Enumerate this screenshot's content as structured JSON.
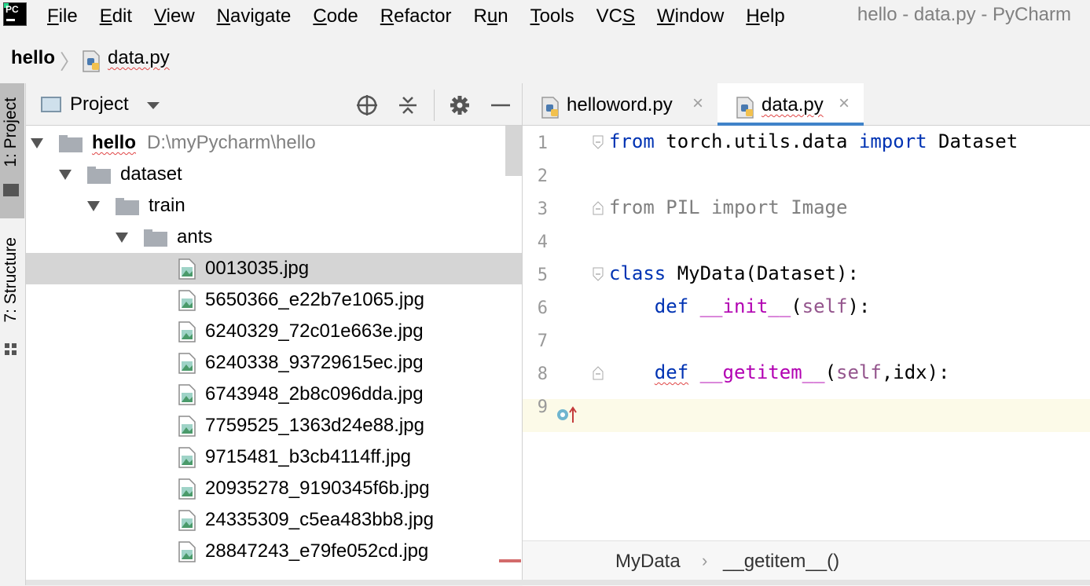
{
  "menubar": {
    "items": [
      {
        "pre": "",
        "mn": "F",
        "post": "ile"
      },
      {
        "pre": "",
        "mn": "E",
        "post": "dit"
      },
      {
        "pre": "",
        "mn": "V",
        "post": "iew"
      },
      {
        "pre": "",
        "mn": "N",
        "post": "avigate"
      },
      {
        "pre": "",
        "mn": "C",
        "post": "ode"
      },
      {
        "pre": "",
        "mn": "R",
        "post": "efactor"
      },
      {
        "pre": "R",
        "mn": "u",
        "post": "n"
      },
      {
        "pre": "",
        "mn": "T",
        "post": "ools"
      },
      {
        "pre": "VC",
        "mn": "S",
        "post": ""
      },
      {
        "pre": "",
        "mn": "W",
        "post": "indow"
      },
      {
        "pre": "",
        "mn": "H",
        "post": "elp"
      }
    ],
    "window_title": "hello - data.py - PyCharm",
    "logo_text": "PC"
  },
  "navbar": {
    "root": "hello",
    "file": "data.py"
  },
  "left_strip": {
    "project_label": "1: Project",
    "structure_label": "7: Structure"
  },
  "project_panel": {
    "title": "Project",
    "tree": [
      {
        "label": "hello",
        "path": "D:\\myPycharm\\hello",
        "type": "root"
      },
      {
        "label": "dataset",
        "type": "folder"
      },
      {
        "label": "train",
        "type": "folder"
      },
      {
        "label": "ants",
        "type": "folder"
      },
      {
        "label": "0013035.jpg",
        "type": "file",
        "selected": true
      },
      {
        "label": "5650366_e22b7e1065.jpg",
        "type": "file"
      },
      {
        "label": "6240329_72c01e663e.jpg",
        "type": "file"
      },
      {
        "label": "6240338_93729615ec.jpg",
        "type": "file"
      },
      {
        "label": "6743948_2b8c096dda.jpg",
        "type": "file"
      },
      {
        "label": "7759525_1363d24e88.jpg",
        "type": "file"
      },
      {
        "label": "9715481_b3cb4114ff.jpg",
        "type": "file"
      },
      {
        "label": "20935278_9190345f6b.jpg",
        "type": "file"
      },
      {
        "label": "24335309_c5ea483bb8.jpg",
        "type": "file"
      },
      {
        "label": "28847243_e79fe052cd.jpg",
        "type": "file"
      }
    ]
  },
  "editor": {
    "tabs": [
      {
        "label": "helloword.py",
        "active": false
      },
      {
        "label": "data.py",
        "active": true
      }
    ],
    "line_numbers": [
      "1",
      "2",
      "3",
      "4",
      "5",
      "6",
      "7",
      "8",
      "9"
    ],
    "code": {
      "l1_kw1": "from",
      "l1_mod": " torch.utils.data ",
      "l1_kw2": "import",
      "l1_name": " Dataset",
      "l3": "from PIL import Image",
      "l5_kw": "class",
      "l5_rest": " MyData(Dataset):",
      "l6_indent": "    ",
      "l6_kw": "def",
      "l6_sp": " ",
      "l6_fn": "__init__",
      "l6_open": "(",
      "l6_self": "self",
      "l6_close": "):",
      "l8_indent": "    ",
      "l8_kw": "def",
      "l8_sp": " ",
      "l8_fn": "__getitem__",
      "l8_open": "(",
      "l8_self": "self",
      "l8_rest": ",idx):"
    },
    "breadcrumb": {
      "class": "MyData",
      "method": "__getitem__()"
    }
  },
  "colors": {
    "keyword": "#0033b3",
    "dunder": "#b200b2",
    "self": "#94558d",
    "active_tab_underline": "#4083c9",
    "current_line": "#fcfae8",
    "selection": "#d5d5d5"
  }
}
